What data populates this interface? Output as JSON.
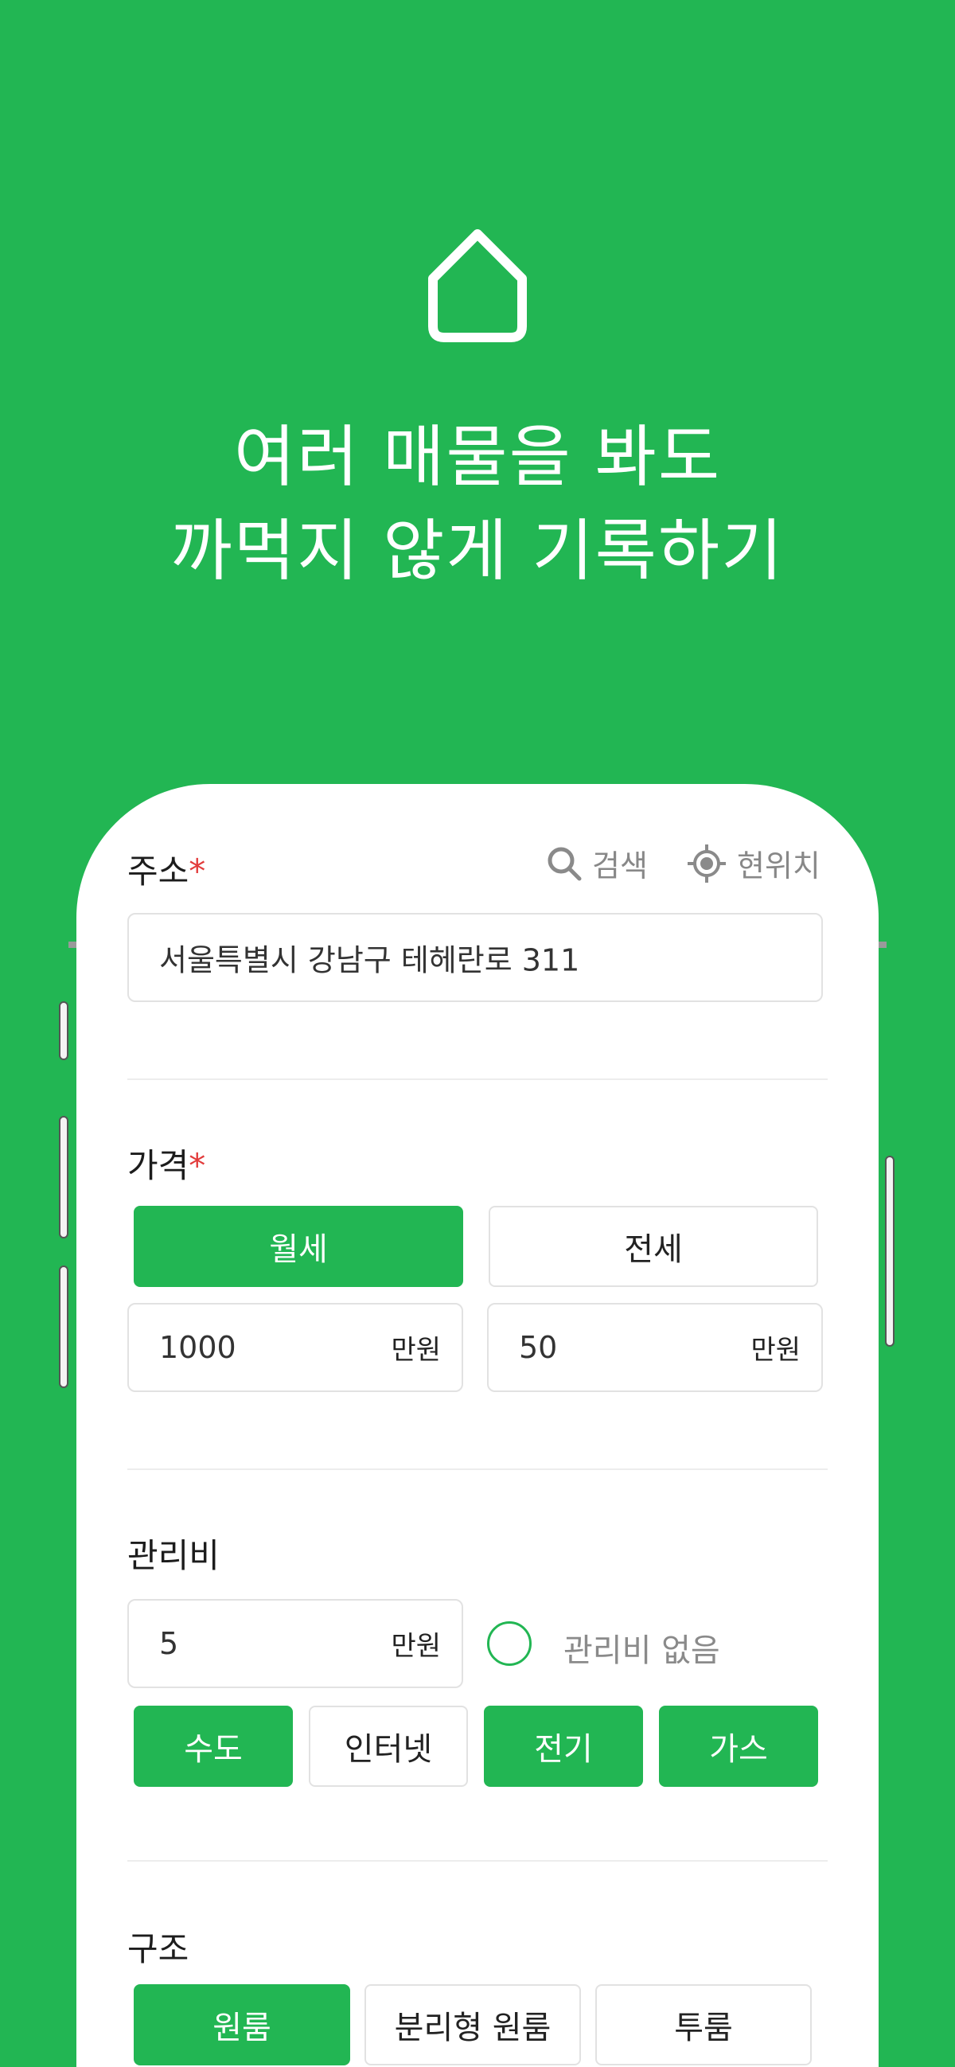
{
  "hero": {
    "icon": "house-outline-icon",
    "headline_line1": "여러 매물을 봐도",
    "headline_line2": "까먹지 않게 기록하기"
  },
  "form": {
    "address": {
      "label": "주소",
      "required_mark": "*",
      "search_icon": "search-icon",
      "search_label": "검색",
      "location_icon": "current-location-icon",
      "location_label": "현위치",
      "value": "서울특별시 강남구 테헤란로 311"
    },
    "price": {
      "label": "가격",
      "required_mark": "*",
      "tabs": [
        {
          "label": "월세",
          "selected": true
        },
        {
          "label": "전세",
          "selected": false
        }
      ],
      "deposit_value": "1000",
      "deposit_unit": "만원",
      "rent_value": "50",
      "rent_unit": "만원"
    },
    "maintenance": {
      "label": "관리비",
      "value": "5",
      "unit": "만원",
      "no_fee_label": "관리비 없음",
      "no_fee_checked": false,
      "options": [
        {
          "label": "수도",
          "selected": true
        },
        {
          "label": "인터넷",
          "selected": false
        },
        {
          "label": "전기",
          "selected": true
        },
        {
          "label": "가스",
          "selected": true
        }
      ]
    },
    "structure": {
      "label": "구조",
      "options": [
        {
          "label": "원룸",
          "selected": true
        },
        {
          "label": "분리형 원룸",
          "selected": false
        },
        {
          "label": "투룸",
          "selected": false
        }
      ]
    }
  },
  "colors": {
    "background": "#22b653",
    "accent": "#22b653",
    "required": "#e23b3b"
  }
}
